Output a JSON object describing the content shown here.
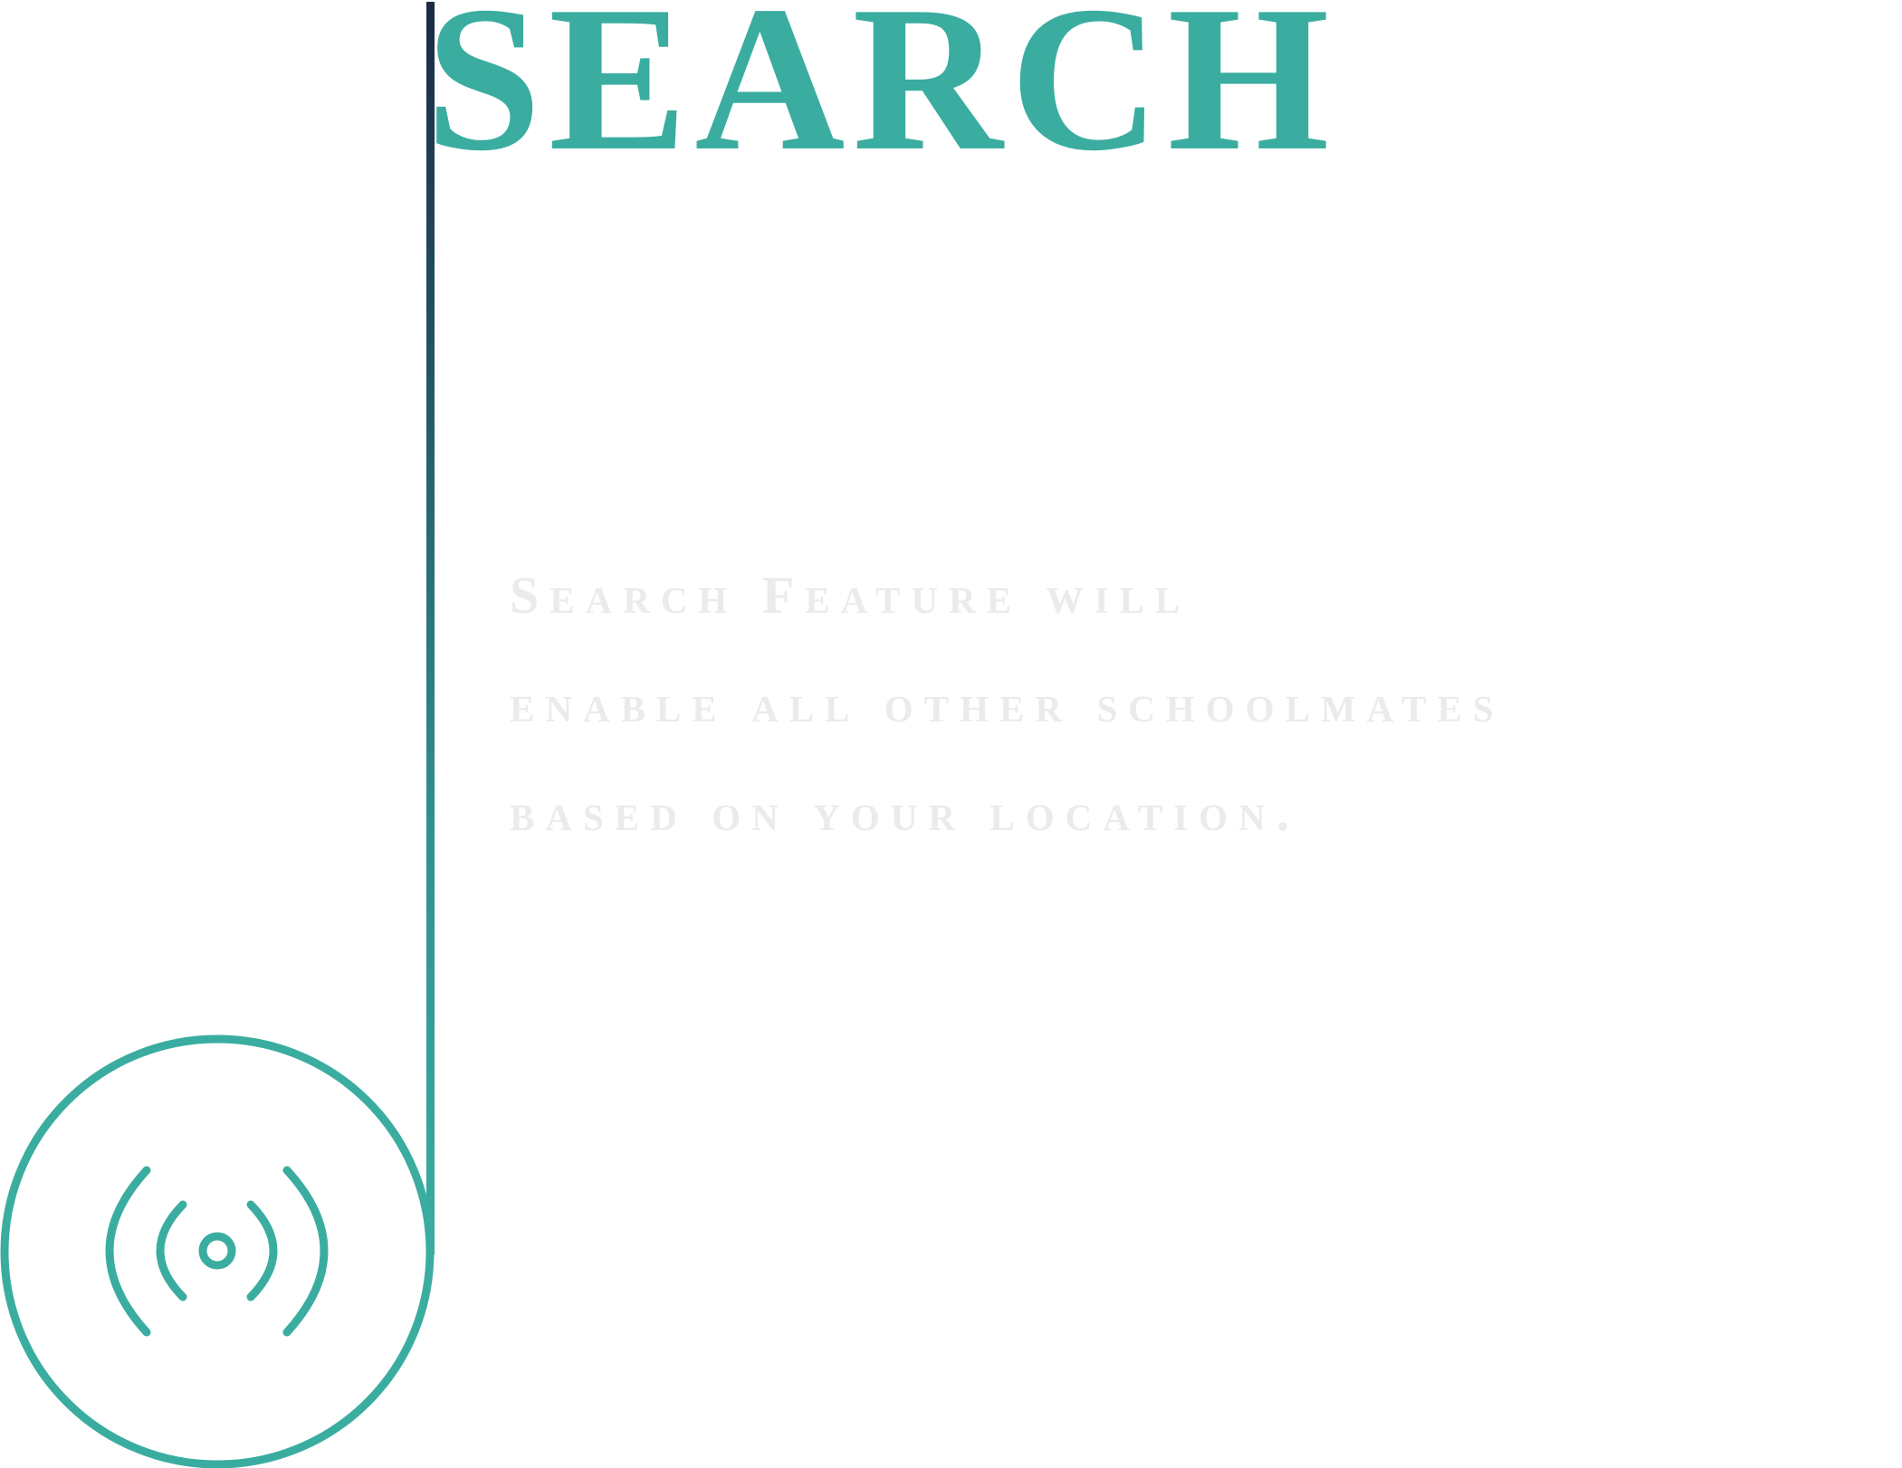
{
  "header": {
    "title": "SEARCH"
  },
  "feature": {
    "description_lines": [
      "Search Feature will",
      "enable all other schoolmates",
      "based on your location."
    ],
    "icon": "broadcast-signal-icon"
  },
  "colors": {
    "accent": "#3aada0",
    "text_muted": "#ebebeb",
    "line_top": "#1c2a44"
  }
}
